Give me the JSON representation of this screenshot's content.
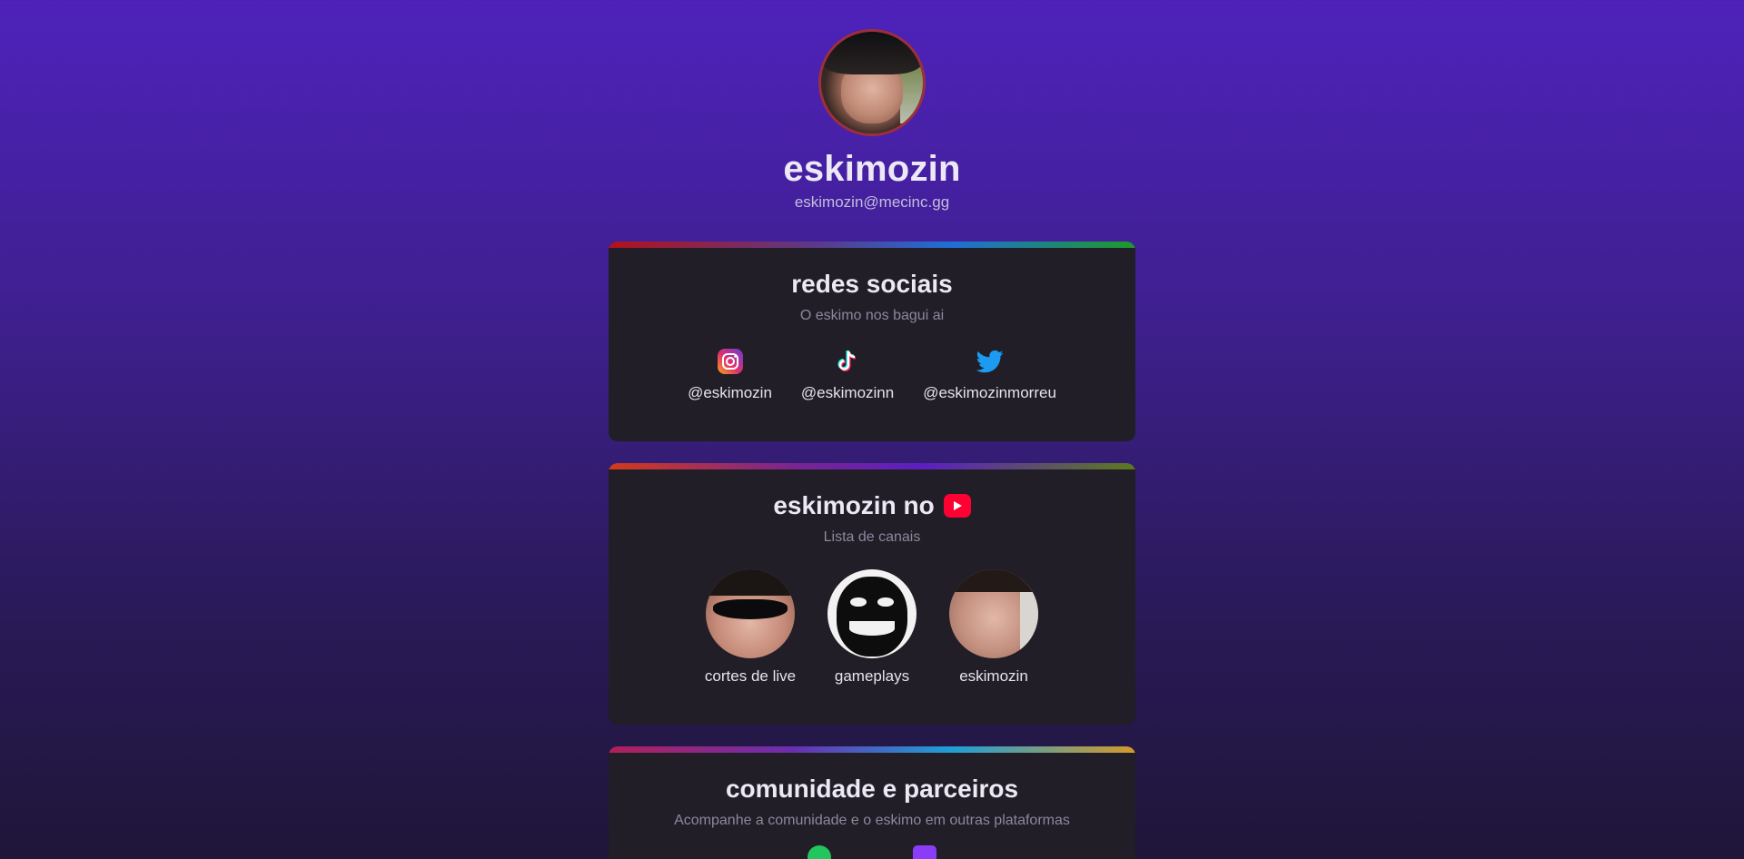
{
  "profile": {
    "username": "eskimozin",
    "email": "eskimozin@mecinc.gg",
    "avatar_icon": "profile-photo"
  },
  "socials_card": {
    "title": "redes sociais",
    "subtitle": "O eskimo nos bagui ai",
    "items": [
      {
        "icon": "instagram-icon",
        "handle": "@eskimozin"
      },
      {
        "icon": "tiktok-icon",
        "handle": "@eskimozinn"
      },
      {
        "icon": "twitter-icon",
        "handle": "@eskimozinmorreu"
      }
    ]
  },
  "youtube_card": {
    "title": "eskimozin no",
    "title_icon": "youtube-icon",
    "subtitle": "Lista de canais",
    "channels": [
      {
        "name": "cortes de live"
      },
      {
        "name": "gameplays"
      },
      {
        "name": "eskimozin"
      }
    ]
  },
  "community_card": {
    "title": "comunidade e parceiros",
    "subtitle": "Acompanhe a comunidade e o eskimo em outras plataformas"
  },
  "colors": {
    "background_top": "#4e22bb",
    "card_bg": "#211e28",
    "youtube_red": "#ff0033",
    "twitter_blue": "#1d9bf0"
  }
}
